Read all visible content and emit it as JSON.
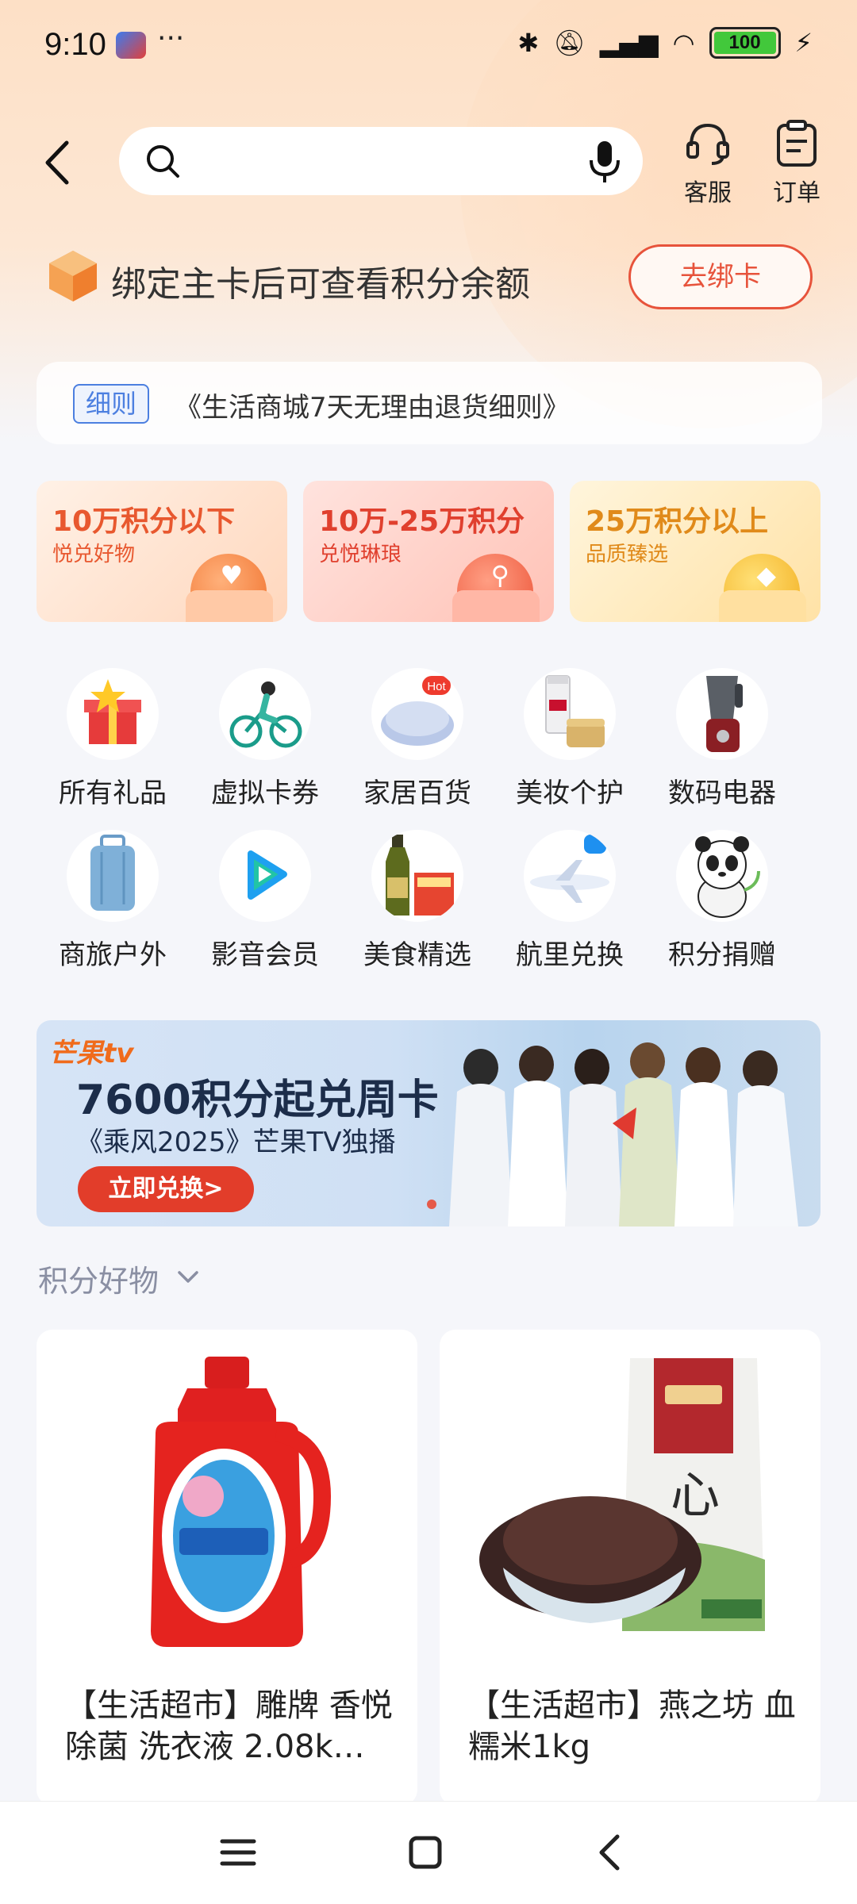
{
  "status_bar": {
    "time": "9:10",
    "dots": "···",
    "battery": "100"
  },
  "header": {
    "service_label": "客服",
    "orders_label": "订单",
    "search_placeholder": ""
  },
  "bind_banner": {
    "text": "绑定主卡后可查看积分余额",
    "button": "去绑卡"
  },
  "notice": {
    "tag": "细则",
    "text": "《生活商城7天无理由退货细则》"
  },
  "tiers": [
    {
      "title": "10万积分以下",
      "subtitle": "悦兑好物",
      "color": "#e8582f"
    },
    {
      "title": "10万-25万积分",
      "subtitle": "兑悦琳琅",
      "color": "#e0402e"
    },
    {
      "title": "25万积分以上",
      "subtitle": "品质臻选",
      "color": "#e08a1a"
    }
  ],
  "categories": [
    {
      "label": "所有礼品",
      "icon": "gift-box-icon"
    },
    {
      "label": "虚拟卡券",
      "icon": "cyclist-icon"
    },
    {
      "label": "家居百货",
      "icon": "pillow-icon",
      "badge": "Hot"
    },
    {
      "label": "美妆个护",
      "icon": "cosmetics-icon"
    },
    {
      "label": "数码电器",
      "icon": "blender-icon"
    },
    {
      "label": "商旅户外",
      "icon": "suitcase-icon"
    },
    {
      "label": "影音会员",
      "icon": "video-play-icon"
    },
    {
      "label": "美食精选",
      "icon": "oil-bottle-icon"
    },
    {
      "label": "航里兑换",
      "icon": "airplane-icon"
    },
    {
      "label": "积分捐赠",
      "icon": "panda-icon"
    }
  ],
  "promo": {
    "brand": "芒果tv",
    "headline": "7600积分起兑周卡",
    "subline": "《乘风2025》芒果TV独播",
    "cta": "立即兑换>"
  },
  "section": {
    "title": "积分好物"
  },
  "products": [
    {
      "name": "【生活超市】雕牌 香悦除菌 洗衣液 2.08k…",
      "icon": "detergent-bottle-icon"
    },
    {
      "name": "【生活超市】燕之坊 血糯米1kg",
      "icon": "rice-bag-icon"
    }
  ],
  "colors": {
    "accent": "#e7533b",
    "tag_blue": "#4c7fe0"
  }
}
